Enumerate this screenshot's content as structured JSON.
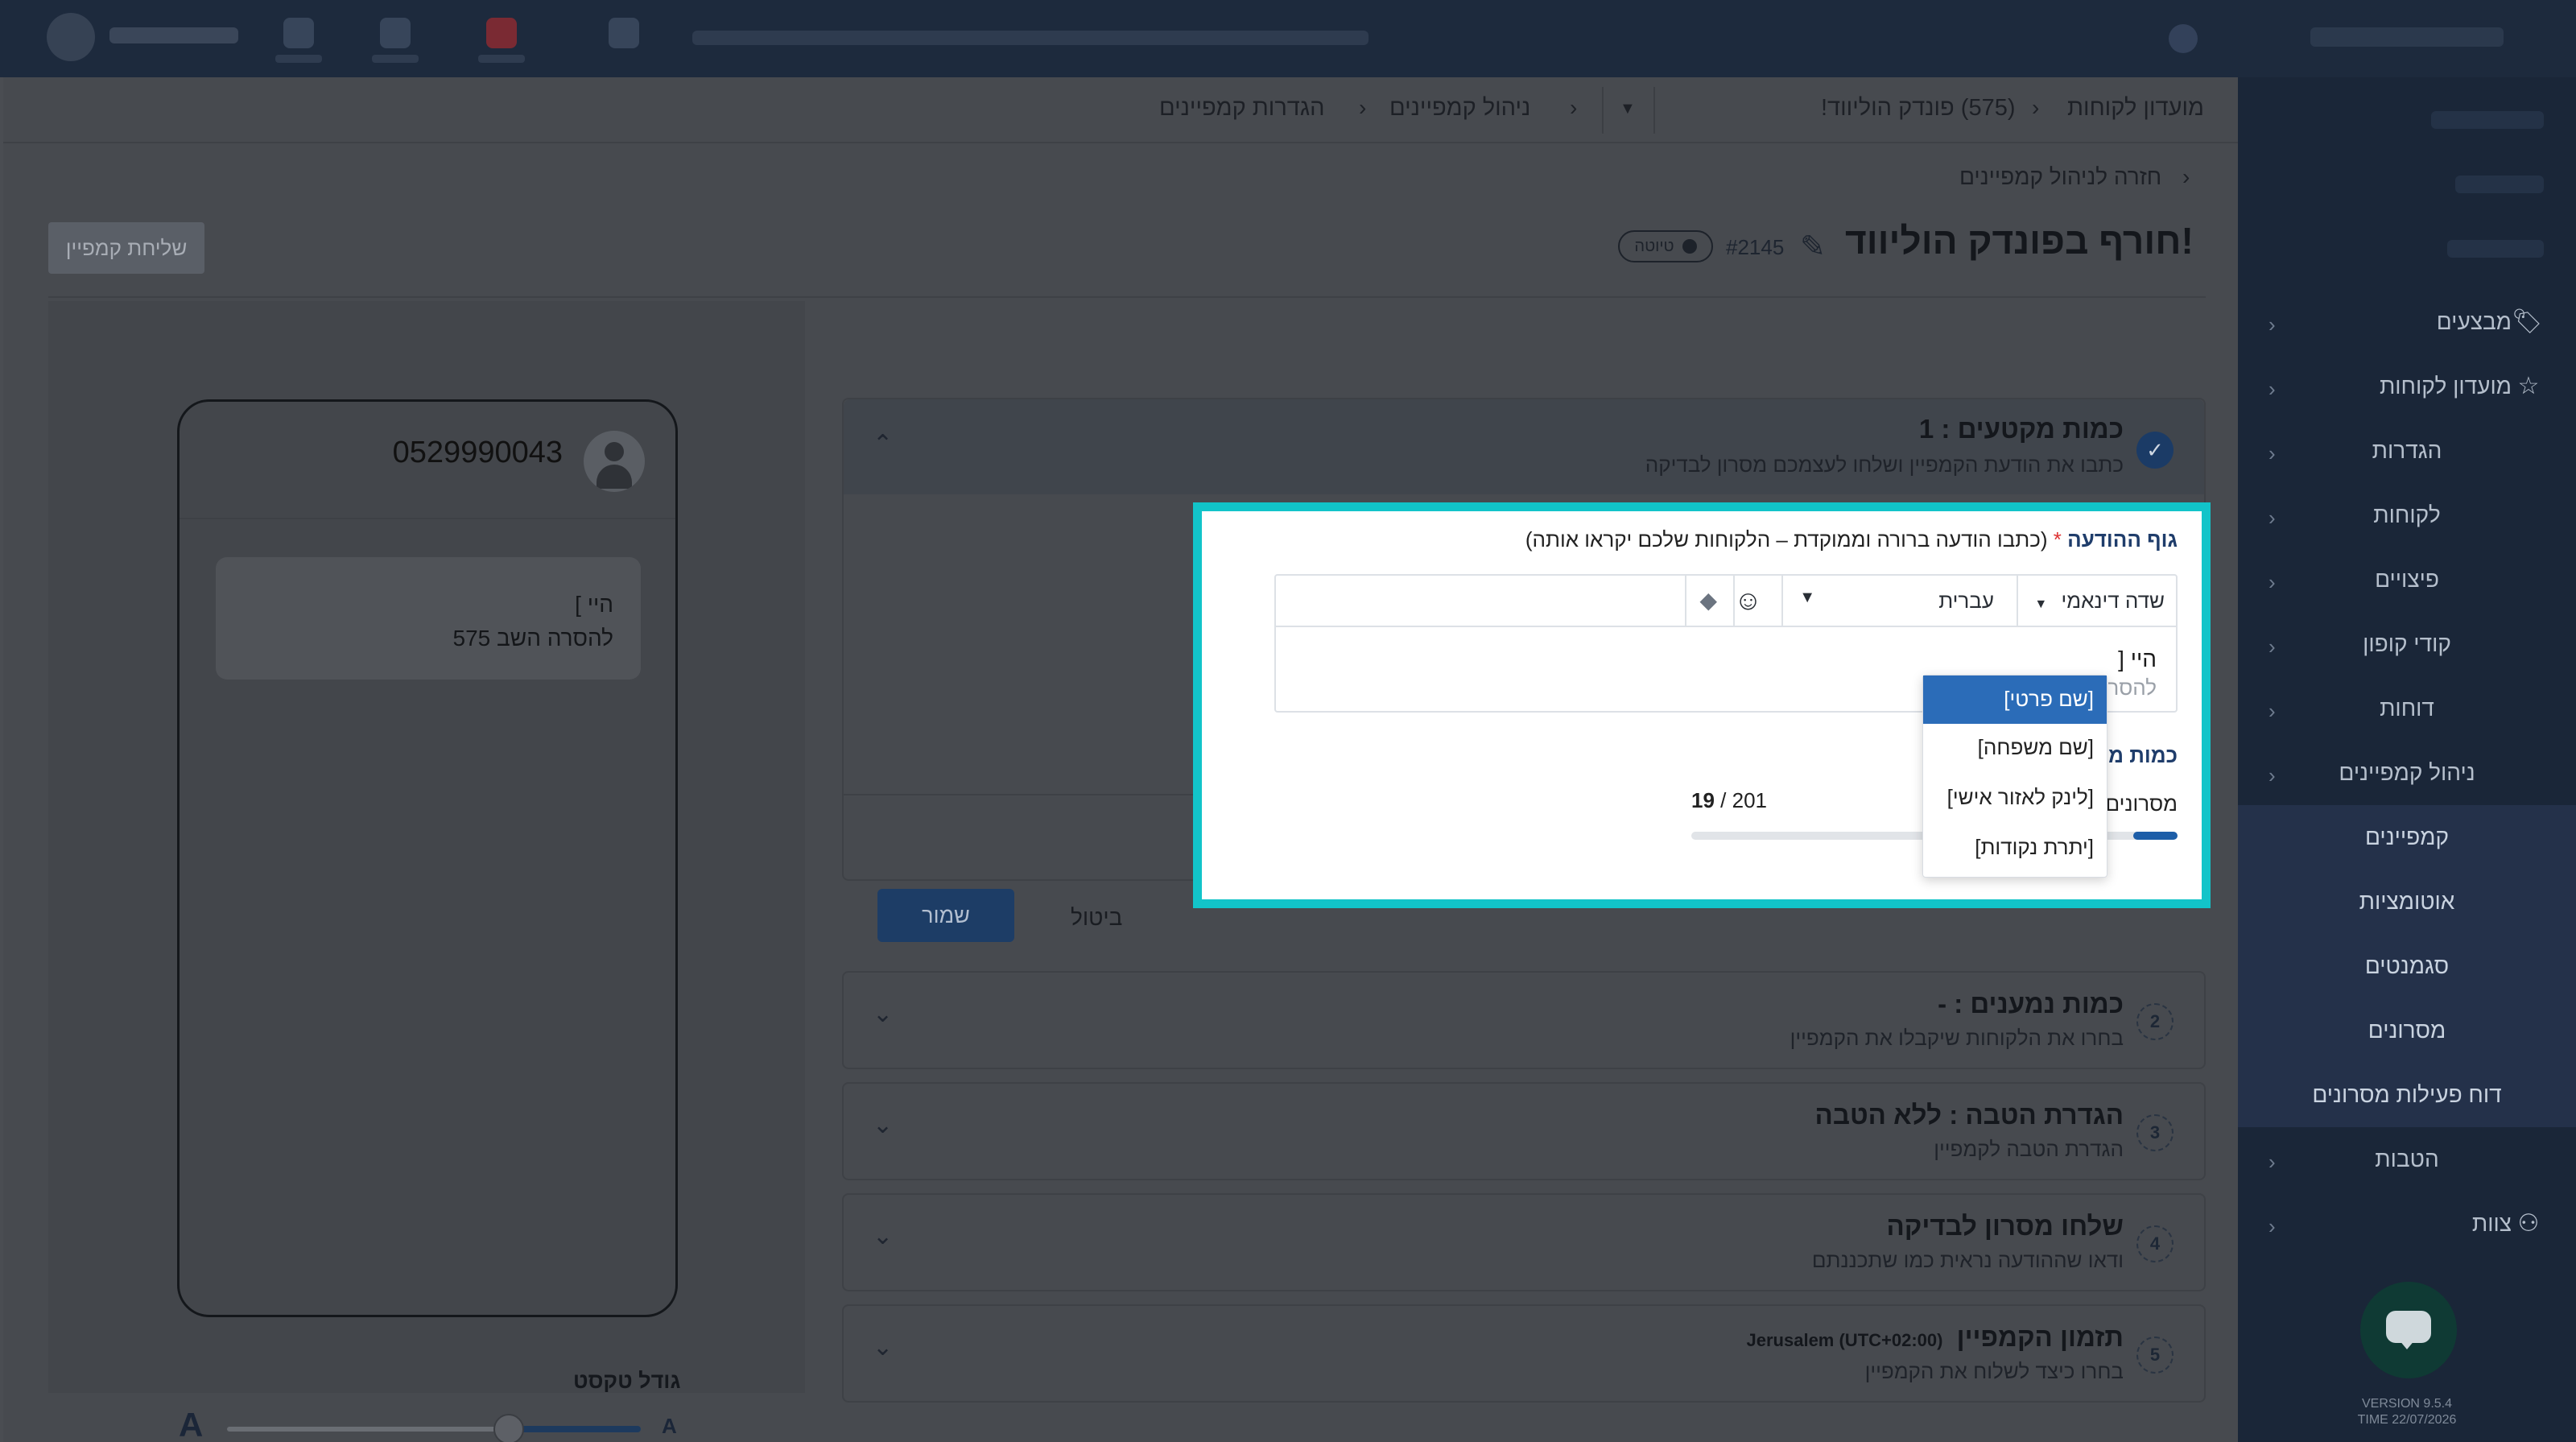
{
  "breadcrumbs": {
    "customer_club": "מועדון לקוחות",
    "branch": "(575) פונדק הוליווד!",
    "campaign_mgmt": "ניהול קמפיינים",
    "campaign_settings": "הגדרות קמפיינים"
  },
  "back_link": "חזרה לניהול קמפיינים",
  "campaign": {
    "title": "חורף בפונדק הוליווד!",
    "id": "#2145",
    "status": "טיוטה",
    "send_button": "שליחת קמפיין"
  },
  "sidebar": {
    "items": [
      {
        "label": "מבצעים",
        "icon": "tag-icon"
      },
      {
        "label": "מועדון לקוחות",
        "icon": "star-icon"
      },
      {
        "label": "הגדרות"
      },
      {
        "label": "לקוחות"
      },
      {
        "label": "פיצויים"
      },
      {
        "label": "קודי קופון"
      },
      {
        "label": "דוחות"
      },
      {
        "label": "ניהול קמפיינים"
      },
      {
        "label": "קמפיינים"
      },
      {
        "label": "אוטומציות"
      },
      {
        "label": "סגמנטים"
      },
      {
        "label": "מסרונים"
      },
      {
        "label": "דוח פעילות מסרונים"
      },
      {
        "label": "הטבות"
      },
      {
        "label": "צוות",
        "icon": "team-icon"
      }
    ],
    "version": "VERSION 9.5.4",
    "time": "TIME 22/07/2026"
  },
  "preview": {
    "phone_number": "0529990043",
    "message_line1": "היי ]",
    "message_line2": "להסרה השב 575",
    "font_size_label": "גודל טקסט",
    "font_small": "A",
    "font_big": "A",
    "font_size_level": 0.68
  },
  "steps": [
    {
      "num": "1",
      "title": "כמות מקטעים : 1",
      "subtitle": "כתבו את הודעת הקמפיין ושלחו לעצמכם מסרון לבדיקה"
    },
    {
      "num": "2",
      "title": "כמות נמענים : -",
      "subtitle": "בחרו את הלקוחות שיקבלו את הקמפיין"
    },
    {
      "num": "3",
      "title": "הגדרת הטבה : ללא הטבה",
      "subtitle": "הגדרת הטבה לקמפיין"
    },
    {
      "num": "4",
      "title": "שלחו מסרון לבדיקה",
      "subtitle": "ודאו שההודעה נראית כמו שתכננתם"
    },
    {
      "num": "5",
      "title": "תזמון הקמפיין",
      "title_extra": "Jerusalem (UTC+02:00)",
      "subtitle": "בחרו כיצד לשלוח את הקמפיין"
    }
  ],
  "editor": {
    "label_bold": "גוף ההודעה",
    "label_req": "*",
    "label_hint": "(כתבו הודעה ברורה וממוקדת – הלקוחות שלכם יקראו אותה)",
    "dynamic_field": "שדה דינאמי",
    "language": "עברית",
    "text_line1": "היי [",
    "text_line2": "להסרה",
    "qty_label": "כמות מקטעים",
    "sms_label": "מסרונים",
    "char_count": "19",
    "char_max": "201",
    "char_fill": 0.095
  },
  "dropdown": {
    "options": [
      "[שם פרטי]",
      "[שם משפחה]",
      "[לינק לאזור אישי]",
      "[יתרת נקודות]"
    ],
    "selected_index": 0
  },
  "buttons": {
    "save": "שמור",
    "cancel": "ביטול"
  }
}
